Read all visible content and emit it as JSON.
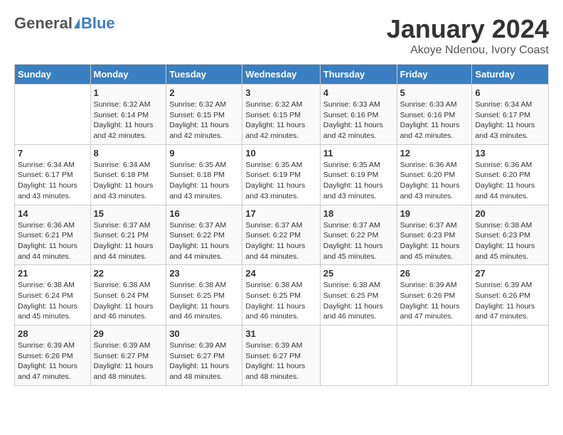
{
  "logo": {
    "general": "General",
    "blue": "Blue"
  },
  "title": "January 2024",
  "subtitle": "Akoye Ndenou, Ivory Coast",
  "days_header": [
    "Sunday",
    "Monday",
    "Tuesday",
    "Wednesday",
    "Thursday",
    "Friday",
    "Saturday"
  ],
  "weeks": [
    [
      {
        "day": "",
        "sunrise": "",
        "sunset": "",
        "daylight": ""
      },
      {
        "day": "1",
        "sunrise": "Sunrise: 6:32 AM",
        "sunset": "Sunset: 6:14 PM",
        "daylight": "Daylight: 11 hours and 42 minutes."
      },
      {
        "day": "2",
        "sunrise": "Sunrise: 6:32 AM",
        "sunset": "Sunset: 6:15 PM",
        "daylight": "Daylight: 11 hours and 42 minutes."
      },
      {
        "day": "3",
        "sunrise": "Sunrise: 6:32 AM",
        "sunset": "Sunset: 6:15 PM",
        "daylight": "Daylight: 11 hours and 42 minutes."
      },
      {
        "day": "4",
        "sunrise": "Sunrise: 6:33 AM",
        "sunset": "Sunset: 6:16 PM",
        "daylight": "Daylight: 11 hours and 42 minutes."
      },
      {
        "day": "5",
        "sunrise": "Sunrise: 6:33 AM",
        "sunset": "Sunset: 6:16 PM",
        "daylight": "Daylight: 11 hours and 42 minutes."
      },
      {
        "day": "6",
        "sunrise": "Sunrise: 6:34 AM",
        "sunset": "Sunset: 6:17 PM",
        "daylight": "Daylight: 11 hours and 43 minutes."
      }
    ],
    [
      {
        "day": "7",
        "sunrise": "Sunrise: 6:34 AM",
        "sunset": "Sunset: 6:17 PM",
        "daylight": "Daylight: 11 hours and 43 minutes."
      },
      {
        "day": "8",
        "sunrise": "Sunrise: 6:34 AM",
        "sunset": "Sunset: 6:18 PM",
        "daylight": "Daylight: 11 hours and 43 minutes."
      },
      {
        "day": "9",
        "sunrise": "Sunrise: 6:35 AM",
        "sunset": "Sunset: 6:18 PM",
        "daylight": "Daylight: 11 hours and 43 minutes."
      },
      {
        "day": "10",
        "sunrise": "Sunrise: 6:35 AM",
        "sunset": "Sunset: 6:19 PM",
        "daylight": "Daylight: 11 hours and 43 minutes."
      },
      {
        "day": "11",
        "sunrise": "Sunrise: 6:35 AM",
        "sunset": "Sunset: 6:19 PM",
        "daylight": "Daylight: 11 hours and 43 minutes."
      },
      {
        "day": "12",
        "sunrise": "Sunrise: 6:36 AM",
        "sunset": "Sunset: 6:20 PM",
        "daylight": "Daylight: 11 hours and 43 minutes."
      },
      {
        "day": "13",
        "sunrise": "Sunrise: 6:36 AM",
        "sunset": "Sunset: 6:20 PM",
        "daylight": "Daylight: 11 hours and 44 minutes."
      }
    ],
    [
      {
        "day": "14",
        "sunrise": "Sunrise: 6:36 AM",
        "sunset": "Sunset: 6:21 PM",
        "daylight": "Daylight: 11 hours and 44 minutes."
      },
      {
        "day": "15",
        "sunrise": "Sunrise: 6:37 AM",
        "sunset": "Sunset: 6:21 PM",
        "daylight": "Daylight: 11 hours and 44 minutes."
      },
      {
        "day": "16",
        "sunrise": "Sunrise: 6:37 AM",
        "sunset": "Sunset: 6:22 PM",
        "daylight": "Daylight: 11 hours and 44 minutes."
      },
      {
        "day": "17",
        "sunrise": "Sunrise: 6:37 AM",
        "sunset": "Sunset: 6:22 PM",
        "daylight": "Daylight: 11 hours and 44 minutes."
      },
      {
        "day": "18",
        "sunrise": "Sunrise: 6:37 AM",
        "sunset": "Sunset: 6:22 PM",
        "daylight": "Daylight: 11 hours and 45 minutes."
      },
      {
        "day": "19",
        "sunrise": "Sunrise: 6:37 AM",
        "sunset": "Sunset: 6:23 PM",
        "daylight": "Daylight: 11 hours and 45 minutes."
      },
      {
        "day": "20",
        "sunrise": "Sunrise: 6:38 AM",
        "sunset": "Sunset: 6:23 PM",
        "daylight": "Daylight: 11 hours and 45 minutes."
      }
    ],
    [
      {
        "day": "21",
        "sunrise": "Sunrise: 6:38 AM",
        "sunset": "Sunset: 6:24 PM",
        "daylight": "Daylight: 11 hours and 45 minutes."
      },
      {
        "day": "22",
        "sunrise": "Sunrise: 6:38 AM",
        "sunset": "Sunset: 6:24 PM",
        "daylight": "Daylight: 11 hours and 46 minutes."
      },
      {
        "day": "23",
        "sunrise": "Sunrise: 6:38 AM",
        "sunset": "Sunset: 6:25 PM",
        "daylight": "Daylight: 11 hours and 46 minutes."
      },
      {
        "day": "24",
        "sunrise": "Sunrise: 6:38 AM",
        "sunset": "Sunset: 6:25 PM",
        "daylight": "Daylight: 11 hours and 46 minutes."
      },
      {
        "day": "25",
        "sunrise": "Sunrise: 6:38 AM",
        "sunset": "Sunset: 6:25 PM",
        "daylight": "Daylight: 11 hours and 46 minutes."
      },
      {
        "day": "26",
        "sunrise": "Sunrise: 6:39 AM",
        "sunset": "Sunset: 6:26 PM",
        "daylight": "Daylight: 11 hours and 47 minutes."
      },
      {
        "day": "27",
        "sunrise": "Sunrise: 6:39 AM",
        "sunset": "Sunset: 6:26 PM",
        "daylight": "Daylight: 11 hours and 47 minutes."
      }
    ],
    [
      {
        "day": "28",
        "sunrise": "Sunrise: 6:39 AM",
        "sunset": "Sunset: 6:26 PM",
        "daylight": "Daylight: 11 hours and 47 minutes."
      },
      {
        "day": "29",
        "sunrise": "Sunrise: 6:39 AM",
        "sunset": "Sunset: 6:27 PM",
        "daylight": "Daylight: 11 hours and 48 minutes."
      },
      {
        "day": "30",
        "sunrise": "Sunrise: 6:39 AM",
        "sunset": "Sunset: 6:27 PM",
        "daylight": "Daylight: 11 hours and 48 minutes."
      },
      {
        "day": "31",
        "sunrise": "Sunrise: 6:39 AM",
        "sunset": "Sunset: 6:27 PM",
        "daylight": "Daylight: 11 hours and 48 minutes."
      },
      {
        "day": "",
        "sunrise": "",
        "sunset": "",
        "daylight": ""
      },
      {
        "day": "",
        "sunrise": "",
        "sunset": "",
        "daylight": ""
      },
      {
        "day": "",
        "sunrise": "",
        "sunset": "",
        "daylight": ""
      }
    ]
  ]
}
